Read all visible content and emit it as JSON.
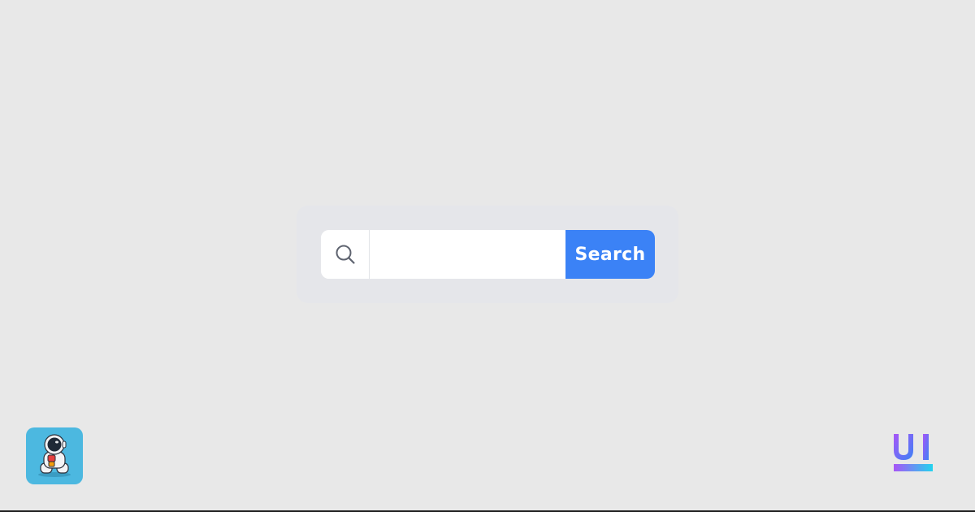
{
  "search": {
    "input_value": "",
    "placeholder": "",
    "button_label": "Search",
    "icon": "search-icon"
  },
  "branding": {
    "avatar_icon": "astronaut-icon",
    "logo_text": "UI",
    "logo_icon": "ui-logo-icon"
  },
  "colors": {
    "page_background": "#e8e8e8",
    "card_background": "#e5e6ea",
    "accent": "#3b82f6",
    "avatar_background": "#4cb8e0",
    "logo_gradient_start": "#a855f7",
    "logo_gradient_end": "#3b82f6"
  }
}
